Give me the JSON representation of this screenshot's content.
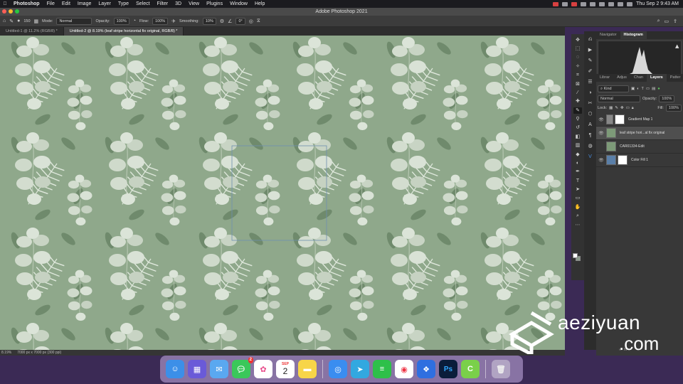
{
  "menubar": {
    "app": "Photoshop",
    "items": [
      "File",
      "Edit",
      "Image",
      "Layer",
      "Type",
      "Select",
      "Filter",
      "3D",
      "View",
      "Plugins",
      "Window",
      "Help"
    ],
    "clock": "Thu Sep 2  9:43 AM"
  },
  "window": {
    "title": "Adobe Photoshop 2021"
  },
  "options": {
    "brush_size": "150",
    "mode_label": "Mode:",
    "mode_value": "Normal",
    "opacity_label": "Opacity:",
    "opacity_value": "100%",
    "flow_label": "Flow:",
    "flow_value": "100%",
    "smoothing_label": "Smoothing:",
    "smoothing_value": "10%",
    "angle_value": "0°"
  },
  "tabs": [
    {
      "label": "Untitled-1 @ 11.2% (RGB/8) *"
    },
    {
      "label": "Untitled-2 @ 8.19% (leaf stripe horizontal fix original, RGB/8) *"
    }
  ],
  "status": {
    "zoom": "8.19%",
    "doc_info": "7000 px x 7000 px (300 ppi)"
  },
  "panels": {
    "top_tabs": [
      "Navigator",
      "Histogram"
    ],
    "layer_tabs": [
      "Librar",
      "Adjus",
      "Chan",
      "Layers",
      "Patter"
    ],
    "kind_label": "Kind",
    "blend_mode": "Normal",
    "opacity_label": "Opacity:",
    "opacity_value": "100%",
    "lock_label": "Lock:",
    "fill_label": "Fill:",
    "fill_value": "100%",
    "layers": [
      {
        "name": "Gradient Map 1"
      },
      {
        "name": "leaf stripe hori...al fix original"
      },
      {
        "name": "CAR01334-Edit"
      },
      {
        "name": "Color Fill 1"
      }
    ],
    "fx_label": "fx"
  },
  "watermark": {
    "text": "aeziyuan",
    "suffix": ".com"
  },
  "dock": {
    "messages_badge": "2",
    "calendar_month": "SEP",
    "calendar_day": "2",
    "photoshop_label": "Ps"
  },
  "colors": {
    "canvas_bg": "#8fa88b",
    "leaf_dark": "#6f8a6c",
    "leaf_light": "#c9d6c5",
    "accent": "#1473e6"
  }
}
